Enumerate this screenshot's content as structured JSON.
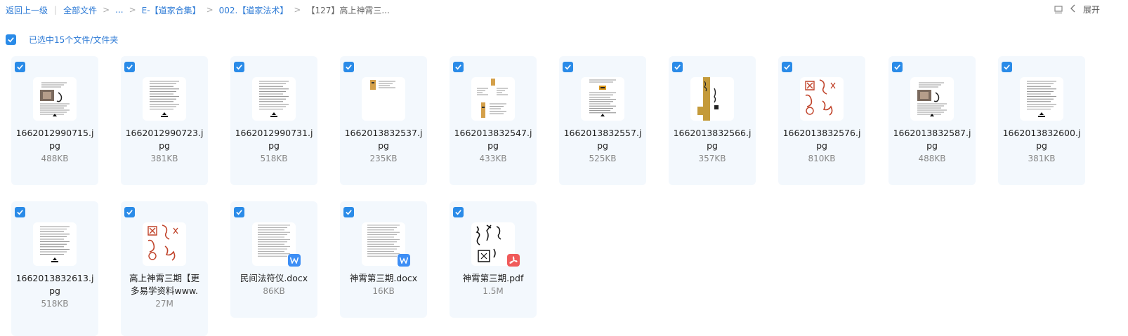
{
  "breadcrumb": {
    "back": "返回上一级",
    "all_files": "全部文件",
    "ellipsis": "...",
    "level1": "E-【道家合集】",
    "level2": "002.【道家法术】",
    "current": "【127】高上神霄三..."
  },
  "toolbar": {
    "expand_label": "展开"
  },
  "selection": {
    "text": "已选中15个文件/文件夹"
  },
  "colors": {
    "accent": "#2a8be8",
    "card_bg": "#f3f8fd",
    "link": "#2e7bd6"
  },
  "files": [
    {
      "name_line1": "1662012990715.j",
      "name_line2": "pg",
      "size": "488KB",
      "kind": "photo"
    },
    {
      "name_line1": "1662012990723.j",
      "name_line2": "pg",
      "size": "381KB",
      "kind": "text"
    },
    {
      "name_line1": "1662012990731.j",
      "name_line2": "pg",
      "size": "518KB",
      "kind": "text"
    },
    {
      "name_line1": "1662013832537.j",
      "name_line2": "pg",
      "size": "235KB",
      "kind": "scroll"
    },
    {
      "name_line1": "1662013832547.j",
      "name_line2": "pg",
      "size": "433KB",
      "kind": "scroll2"
    },
    {
      "name_line1": "1662013832557.j",
      "name_line2": "pg",
      "size": "525KB",
      "kind": "text2"
    },
    {
      "name_line1": "1662013832566.j",
      "name_line2": "pg",
      "size": "357KB",
      "kind": "gold"
    },
    {
      "name_line1": "1662013832576.j",
      "name_line2": "pg",
      "size": "810KB",
      "kind": "seal"
    },
    {
      "name_line1": "1662013832587.j",
      "name_line2": "pg",
      "size": "488KB",
      "kind": "photo"
    },
    {
      "name_line1": "1662013832600.j",
      "name_line2": "pg",
      "size": "381KB",
      "kind": "text"
    },
    {
      "name_line1": "1662013832613.j",
      "name_line2": "pg",
      "size": "518KB",
      "kind": "text"
    },
    {
      "name_line1": "高上神霄三期【更",
      "name_line2": "多易学资料www.",
      "size": "27M",
      "kind": "seal"
    },
    {
      "name_line1": "民间法符仪.docx",
      "name_line2": "",
      "size": "86KB",
      "kind": "docx"
    },
    {
      "name_line1": "神霄第三期.docx",
      "name_line2": "",
      "size": "16KB",
      "kind": "docx"
    },
    {
      "name_line1": "神霄第三期.pdf",
      "name_line2": "",
      "size": "1.5M",
      "kind": "pdf"
    }
  ]
}
